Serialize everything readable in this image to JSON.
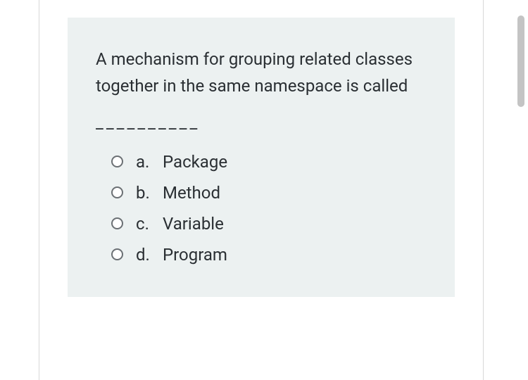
{
  "question": {
    "text": "A mechanism for grouping related classes together in the same namespace is called",
    "blank": "__________"
  },
  "options": [
    {
      "letter": "a.",
      "text": "Package"
    },
    {
      "letter": "b.",
      "text": "Method"
    },
    {
      "letter": "c.",
      "text": "Variable"
    },
    {
      "letter": "d.",
      "text": "Program"
    }
  ]
}
